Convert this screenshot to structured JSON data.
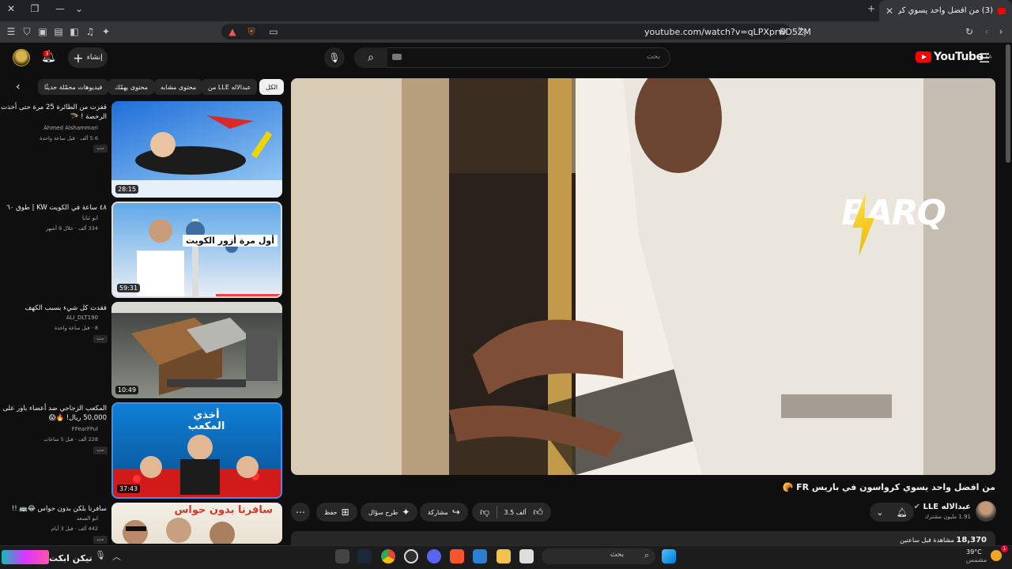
{
  "browser": {
    "tab_title": "(3) من افضل واحد يسوي كرواس...",
    "url": "youtube.com/watch?v=qLPXprwD5ZM"
  },
  "youtube": {
    "logo_text": "YouTube",
    "region": "SA",
    "search_placeholder": "بحث",
    "create_label": "إنشاء",
    "notification_count": "3"
  },
  "chips": [
    "الكل",
    "من LLE عبدالاله",
    "محتوى مشابه",
    "محتوى يهمّك",
    "فيديوهات محمّلة حديثًا"
  ],
  "video": {
    "title": "من افضل واحد يسوي كرواسون في باريس FR 🥐",
    "channel": "عبدالاله LLE",
    "subscribers": "1.91 مليون مشترك",
    "likes": "3.5 ألف",
    "share_label": "مشاركة",
    "ask_label": "طرح سؤال",
    "save_label": "حفظ",
    "views": "18,370",
    "uploaded": "مشاهدة قبل ساعتين",
    "overlay_logo": "BARQ"
  },
  "recommendations": [
    {
      "title": "قفزت من الطائرة 25 مرة حتى أخذت الرخصة ! 🪂",
      "channel": "Ahmed Alshammari",
      "meta": "5.6 ألف · قبل ساعة واحدة",
      "duration": "28:15",
      "badge": "جديد",
      "colors": [
        "#1e6fd9",
        "#9fd0f5"
      ]
    },
    {
      "title": "٤٨ ساعة في الكويت KW | طوق ٦٠",
      "channel": "ابو ثنايا",
      "meta": "334 ألف · خلال 9 أشهر",
      "duration": "59:31",
      "overlay": "أول مرة أزور الكويت",
      "colors": [
        "#5fa8e8",
        "#e9eef5"
      ]
    },
    {
      "title": "فقدت كل شيء بسبب الكهف",
      "channel": "ALI_DLT190",
      "meta": "8 · قبل ساعة واحدة",
      "duration": "10:49",
      "badge": "جديد",
      "colors": [
        "#3a3d3a",
        "#8a8f86"
      ]
    },
    {
      "title": "المكعب الزجاجي ضد أعضاء باور على 50,000 ريال! 🔥😱",
      "channel": "FFearFFul",
      "meta": "228 ألف · قبل 5 ساعات",
      "duration": "37:43",
      "overlay": "أخذي المكعب",
      "badge": "جديد",
      "colors": [
        "#0e7fd6",
        "#d11b1b"
      ]
    },
    {
      "title": "سافرنا بلكن بدون حواس 😂🚌 !!",
      "channel": "ابو السعد",
      "meta": "442 ألف · قبل 3 أيام",
      "overlay": "سافرنا بدون حواس",
      "badge": "جديد",
      "colors": [
        "#f3efe6",
        "#d63a2f"
      ]
    }
  ],
  "taskbar": {
    "search_placeholder": "بحث",
    "temperature": "39°C",
    "condition": "مشمس",
    "tray_text": "تيكن ابكت",
    "weather_badge": "1"
  }
}
